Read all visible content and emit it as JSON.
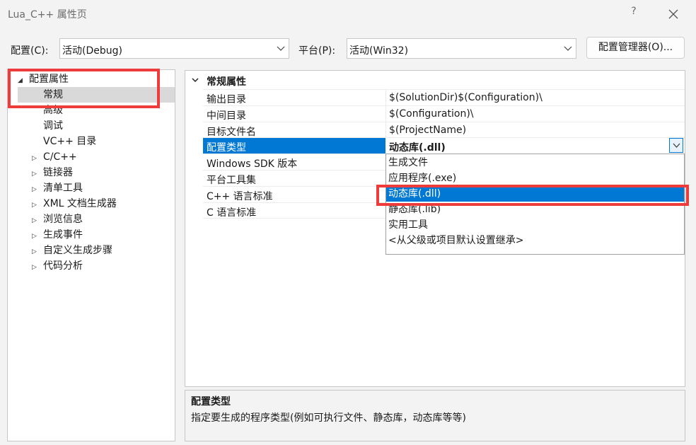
{
  "window": {
    "title": "Lua_C++ 属性页",
    "help": "?"
  },
  "toolbar": {
    "config_label": "配置(C):",
    "config_value": "活动(Debug)",
    "platform_label": "平台(P):",
    "platform_value": "活动(Win32)",
    "manager_button": "配置管理器(O)..."
  },
  "tree": {
    "root": "配置属性",
    "children": [
      "常规",
      "高级",
      "调试",
      "VC++ 目录"
    ],
    "groups": [
      "C/C++",
      "链接器",
      "清单工具",
      "XML 文档生成器",
      "浏览信息",
      "生成事件",
      "自定义生成步骤",
      "代码分析"
    ],
    "selected": "常规"
  },
  "grid": {
    "category": "常规属性",
    "rows": [
      {
        "name": "输出目录",
        "value": "$(SolutionDir)$(Configuration)\\"
      },
      {
        "name": "中间目录",
        "value": "$(Configuration)\\"
      },
      {
        "name": "目标文件名",
        "value": "$(ProjectName)"
      },
      {
        "name": "配置类型",
        "value": "动态库(.dll)"
      },
      {
        "name": "Windows SDK 版本",
        "value": ""
      },
      {
        "name": "平台工具集",
        "value": ""
      },
      {
        "name": "C++ 语言标准",
        "value": ""
      },
      {
        "name": "C 语言标准",
        "value": ""
      }
    ]
  },
  "dropdown": {
    "options": [
      "生成文件",
      "应用程序(.exe)",
      "动态库(.dll)",
      "静态库(.lib)",
      "实用工具",
      "<从父级或项目默认设置继承>"
    ],
    "selected": "动态库(.dll)"
  },
  "description": {
    "title": "配置类型",
    "text": "指定要生成的程序类型(例如可执行文件、静态库，动态库等等)"
  },
  "colors": {
    "accent": "#0078d4",
    "highlight": "#ee3b3b"
  }
}
